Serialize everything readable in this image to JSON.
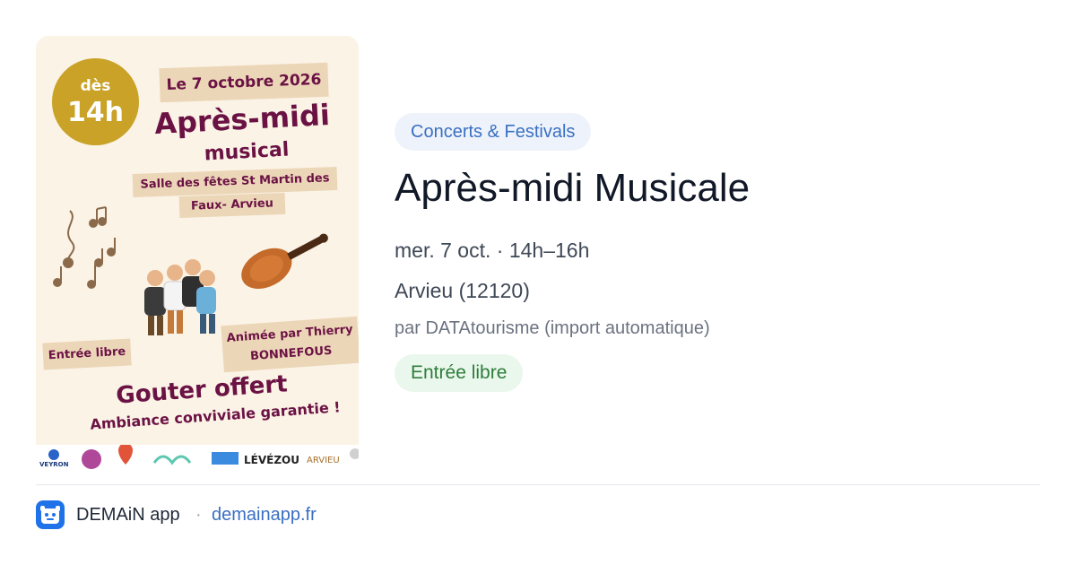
{
  "colors": {
    "poster_bg": "#fbf3e6",
    "poster_accent": "#6b1244",
    "category_text": "#3a6fc2",
    "category_bg": "#eef3fb",
    "free_text": "#2e7d3a",
    "free_bg": "#eaf7ed",
    "app_icon": "#1f72e8"
  },
  "poster": {
    "time_prefix": "dès",
    "time": "14h",
    "date": "Le 7 octobre 2026",
    "headline": "Après-midi",
    "subheadline": "musical",
    "venue_line1": "Salle des fêtes St Martin des",
    "venue_line2": "Faux- Arvieu",
    "entry": "Entrée libre",
    "host_line1": "Animée par Thierry",
    "host_line2": "BONNEFOUS",
    "snack": "Gouter offert",
    "tagline": "Ambiance conviviale garantie !",
    "sponsor_logos": [
      "VEYRON",
      "LÉVÉZOU",
      "ARVIEU"
    ]
  },
  "event": {
    "category": "Concerts & Festivals",
    "title": "Après-midi Musicale",
    "datetime": "mer. 7 oct. · 14h–16h",
    "location": "Arvieu (12120)",
    "source": "par DATAtourisme (import automatique)",
    "price": "Entrée libre"
  },
  "footer": {
    "app_name": "DEMAiN app",
    "separator": "·",
    "domain": "demainapp.fr",
    "icon": "demain-app-icon"
  }
}
